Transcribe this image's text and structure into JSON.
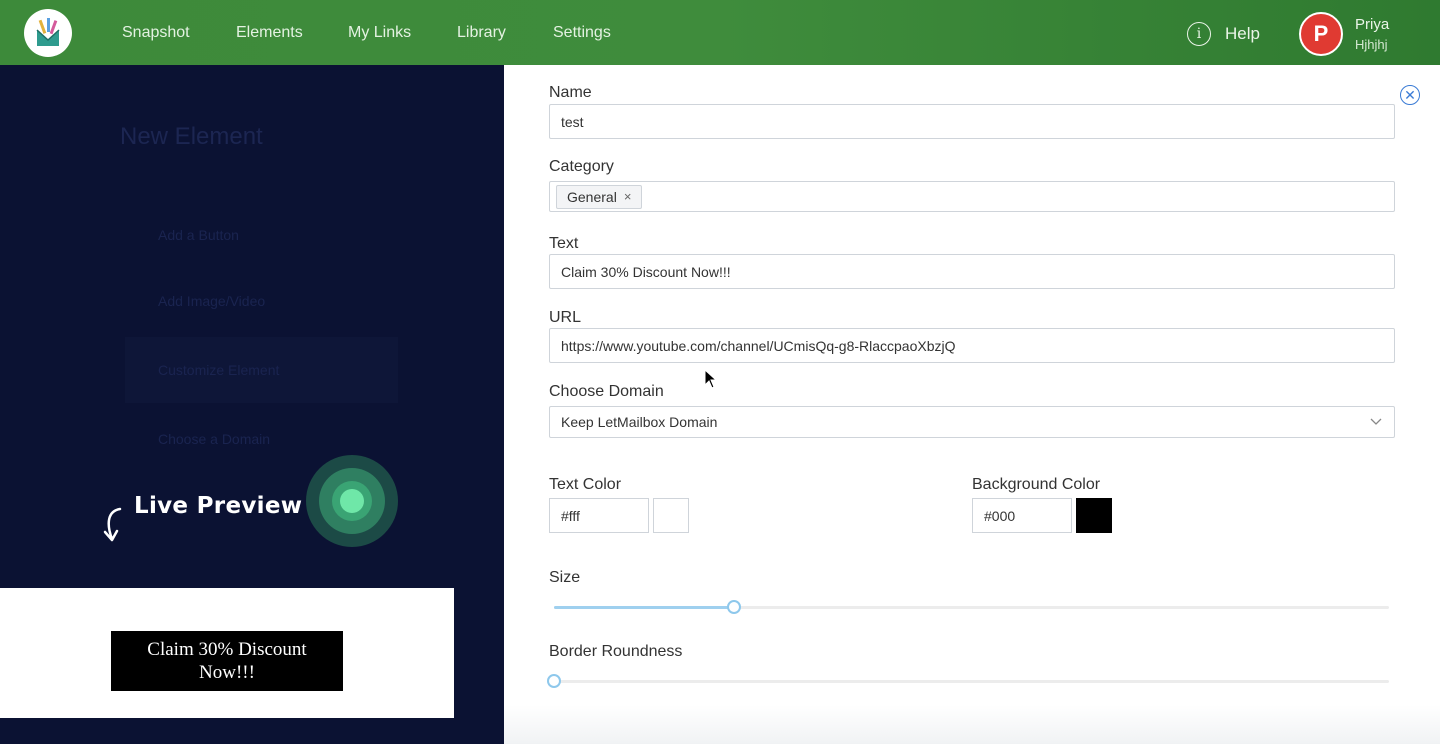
{
  "nav": {
    "items": [
      "Snapshot",
      "Elements",
      "My Links",
      "Library",
      "Settings"
    ],
    "help_label": "Help",
    "user": {
      "initial": "P",
      "name": "Priya",
      "subtitle": "Hjhjhj"
    }
  },
  "left": {
    "ghost_title": "New Element",
    "ghost_items": [
      "Add a Button",
      "Add Image/Video",
      "Customize Element",
      "Choose a Domain"
    ],
    "live_preview": "Live Preview",
    "preview_button": "Claim 30% Discount Now!!!"
  },
  "form": {
    "name_label": "Name",
    "name_value": "test",
    "category_label": "Category",
    "category_tag": "General",
    "text_label": "Text",
    "text_value": "Claim 30% Discount Now!!!",
    "url_label": "URL",
    "url_value": "https://www.youtube.com/channel/UCmisQq-g8-RlaccpaoXbzjQ",
    "domain_label": "Choose Domain",
    "domain_value": "Keep LetMailbox Domain",
    "text_color_label": "Text Color",
    "text_color_value": "#fff",
    "bg_color_label": "Background Color",
    "bg_color_value": "#000",
    "size_label": "Size",
    "size_level": 0.215,
    "border_label": "Border Roundness",
    "border_level": 0
  },
  "colors": {
    "nav_bg": "#3d8a3a",
    "accent": "#3a7bd5",
    "avatar": "#e03a32",
    "overlay": "#0b1233",
    "live_dot": "#6fe7a8"
  }
}
